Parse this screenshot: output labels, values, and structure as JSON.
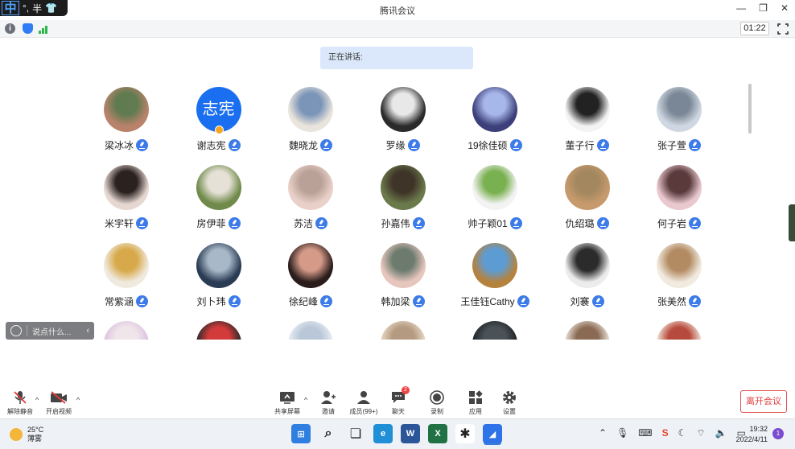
{
  "ime": {
    "mode": "中",
    "punct": "°,",
    "width": "半"
  },
  "window": {
    "title": "腾讯会议",
    "minimize": "—",
    "restore": "❐",
    "close": "✕"
  },
  "meeting": {
    "elapsed": "01:22",
    "speaking_label": "正在讲话:"
  },
  "participants": [
    {
      "name": "梁冰冰",
      "av": "#b9826b",
      "av2": "#5f7b4f"
    },
    {
      "name": "谢志宪",
      "text": "志宪",
      "host": true
    },
    {
      "name": "魏晓龙",
      "av": "#e9e4dc",
      "av2": "#7b95b8"
    },
    {
      "name": "罗缘",
      "av": "#2a2a2a",
      "av2": "#e8e8e8"
    },
    {
      "name": "19徐佳硕",
      "av": "#3d3f7a",
      "av2": "#a7b7ea"
    },
    {
      "name": "董子行",
      "av": "#f3f3f3",
      "av2": "#222222"
    },
    {
      "name": "张子萱",
      "av": "#cfd8e2",
      "av2": "#7a8796"
    },
    {
      "name": "米宇轩",
      "av": "#e6d7d1",
      "av2": "#2b2220"
    },
    {
      "name": "房伊菲",
      "av": "#6f8a4a",
      "av2": "#e6e1d6"
    },
    {
      "name": "苏洁",
      "av": "#e9d1c9",
      "av2": "#b9a197"
    },
    {
      "name": "孙嘉伟",
      "av": "#6b7a4b",
      "av2": "#3f3428"
    },
    {
      "name": "帅子颖01",
      "av": "#f3f3f3",
      "av2": "#79b050"
    },
    {
      "name": "仇绍璐",
      "av": "#c79a6d",
      "av2": "#a3875f"
    },
    {
      "name": "何子岩",
      "av": "#e9c9cf",
      "av2": "#5b3a3c"
    },
    {
      "name": "常紫涵",
      "av": "#f0e9de",
      "av2": "#d7a94a"
    },
    {
      "name": "刘卜玮",
      "av": "#2a3b54",
      "av2": "#a8b8c8"
    },
    {
      "name": "徐纪峰",
      "av": "#2a1d1c",
      "av2": "#d59a88"
    },
    {
      "name": "韩加梁",
      "av": "#e6c6bd",
      "av2": "#6d7b6f"
    },
    {
      "name": "王佳钰Cathy",
      "av": "#b5823d",
      "av2": "#5d9cd3"
    },
    {
      "name": "刘褰",
      "av": "#ececec",
      "av2": "#2b2b2b"
    },
    {
      "name": "张美然",
      "av": "#f1eadf",
      "av2": "#b38b63"
    },
    {
      "name": "",
      "av": "#dcc2e0",
      "av2": "#f0e6ea"
    },
    {
      "name": "",
      "av": "#2a2a2a",
      "av2": "#d33a3a"
    },
    {
      "name": "",
      "av": "#e9eef4",
      "av2": "#b9c7d8"
    },
    {
      "name": "",
      "av": "#e9d8c5",
      "av2": "#b39a80"
    },
    {
      "name": "",
      "av": "#1e2326",
      "av2": "#4a5257"
    },
    {
      "name": "",
      "av": "#ece3da",
      "av2": "#8a6a52"
    },
    {
      "name": "",
      "av": "#f3e3d6",
      "av2": "#b64a3d"
    }
  ],
  "chat": {
    "placeholder": "说点什么...",
    "collapse": "‹"
  },
  "controls": {
    "unmute": "解除静音",
    "video": "开启视频",
    "share": "共享屏幕",
    "invite": "邀请",
    "members": "成员(99+)",
    "chat": "聊天",
    "chat_badge": "2",
    "record": "录制",
    "apps": "应用",
    "settings": "设置",
    "leave": "离开会议"
  },
  "taskbar": {
    "temp": "25°C",
    "weather": "薄雾",
    "time": "19:32",
    "date": "2022/4/11",
    "notifications": "1",
    "apps": [
      {
        "name": "windows-start",
        "glyph": "⊞",
        "color": "#2f7fe0"
      },
      {
        "name": "search",
        "glyph": "⌕",
        "color": "#eef1f6"
      },
      {
        "name": "task-view",
        "glyph": "❏",
        "color": "#eef1f6"
      },
      {
        "name": "edge",
        "glyph": "e",
        "color": "#1f8fd6"
      },
      {
        "name": "word",
        "glyph": "W",
        "color": "#2b579a"
      },
      {
        "name": "excel",
        "glyph": "X",
        "color": "#207245"
      },
      {
        "name": "media",
        "glyph": "✱",
        "color": "#ffffff"
      },
      {
        "name": "tencent-meeting",
        "glyph": "◢",
        "color": "#2e73e8"
      }
    ]
  }
}
